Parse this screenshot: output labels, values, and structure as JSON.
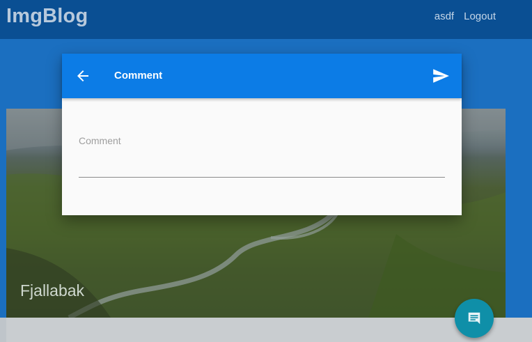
{
  "app": {
    "brand": "ImgBlog",
    "nav": {
      "user_label": "asdf",
      "logout_label": "Logout"
    }
  },
  "post": {
    "title": "Fjallabak"
  },
  "dialog": {
    "title": "Comment",
    "back_icon": "arrow-back-icon",
    "send_icon": "send-icon",
    "field": {
      "label": "Comment",
      "value": "",
      "placeholder": ""
    }
  },
  "fab": {
    "icon": "comment-icon"
  },
  "colors": {
    "app_bar": "#0a4f93",
    "dialog_bar": "#0c7ce6",
    "fab": "#0f8fa8",
    "page_background": "#1b6fc0"
  }
}
